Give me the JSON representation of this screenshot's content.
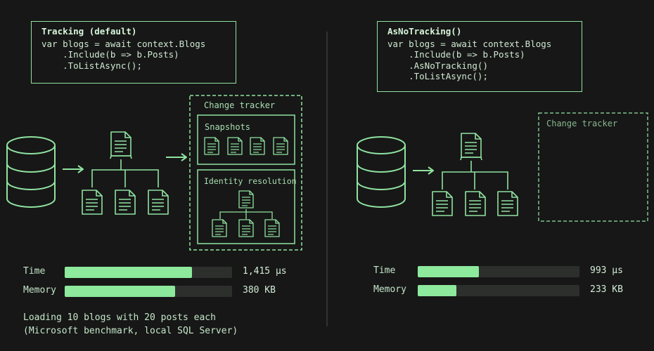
{
  "left": {
    "code_title": "Tracking (default)",
    "code_lines": [
      "var blogs = await context.Blogs",
      "    .Include(b => b.Posts)",
      "    .ToListAsync();"
    ],
    "tracker_title": "Change tracker",
    "snapshots_title": "Snapshots",
    "identity_title": "Identity resolution",
    "metrics": {
      "time_label": "Time",
      "time_value": "1,415 µs",
      "time_fraction": 0.76,
      "memory_label": "Memory",
      "memory_value": "380 KB",
      "memory_fraction": 0.66
    },
    "caption_lines": [
      "Loading 10 blogs with 20 posts each",
      "(Microsoft benchmark, local SQL Server)"
    ]
  },
  "right": {
    "code_title": "AsNoTracking()",
    "code_lines": [
      "var blogs = await context.Blogs",
      "    .Include(b => b.Posts)",
      "    .AsNoTracking()",
      "    .ToListAsync();"
    ],
    "tracker_title": "Change tracker",
    "metrics": {
      "time_label": "Time",
      "time_value": "993 µs",
      "time_fraction": 0.38,
      "memory_label": "Memory",
      "memory_value": "233 KB",
      "memory_fraction": 0.24
    }
  },
  "colors": {
    "background": "#171717",
    "accent": "#8fe3a0",
    "bar_fill": "#8de99c",
    "bar_track": "#2c2f2c"
  }
}
